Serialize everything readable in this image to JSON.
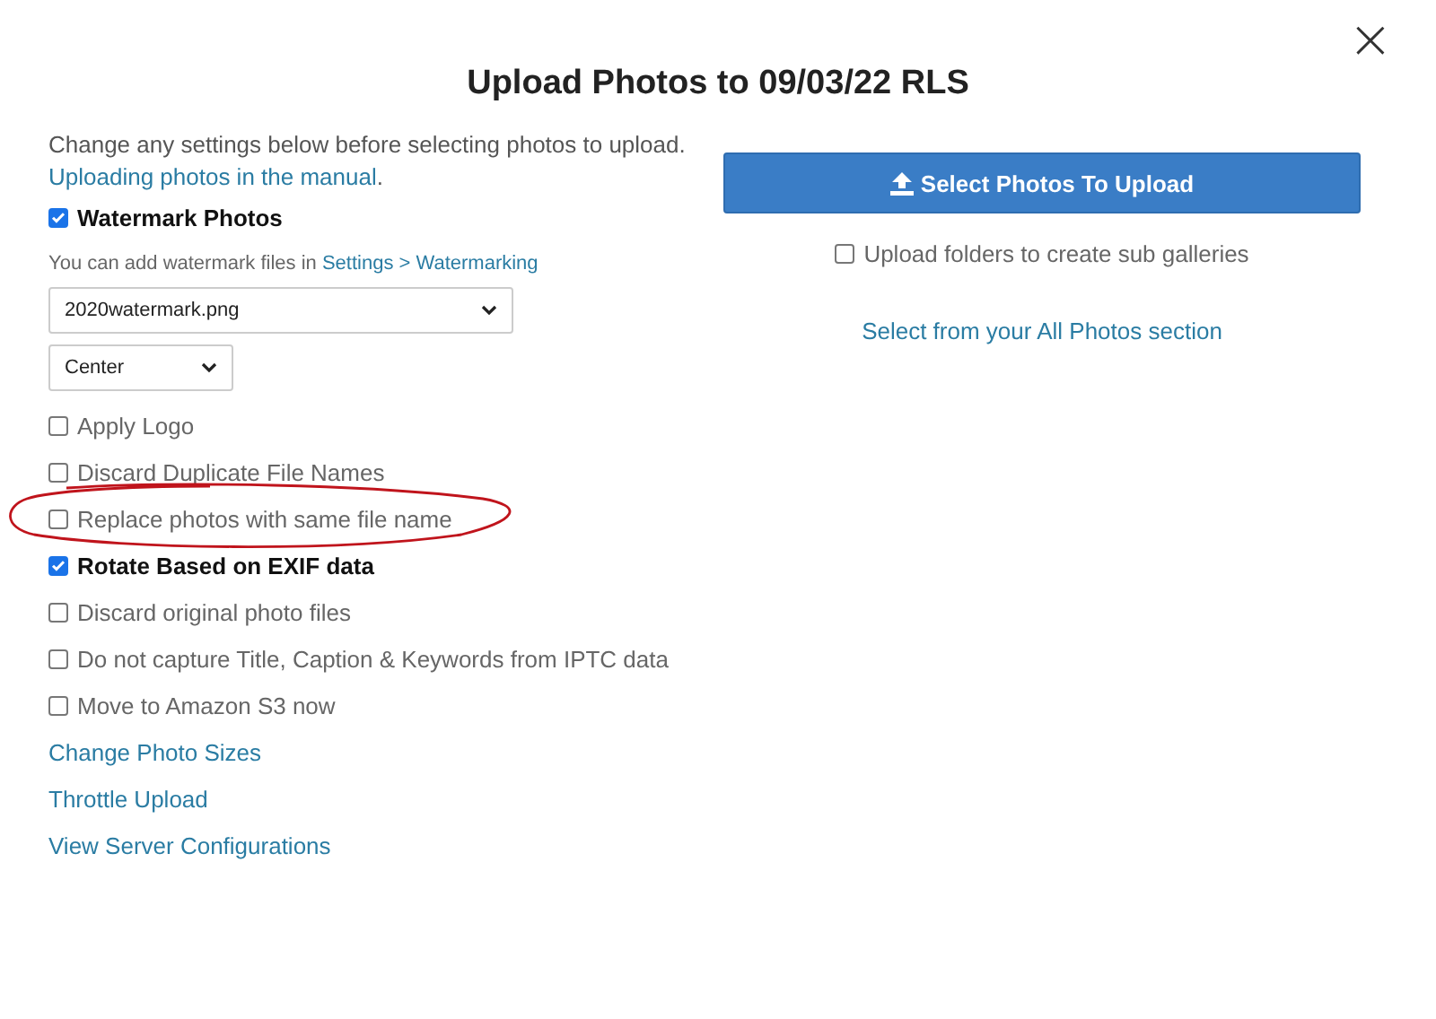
{
  "dialog": {
    "title": "Upload Photos to 09/03/22 RLS",
    "close": "×"
  },
  "intro": {
    "text": "Change any settings below before selecting photos to upload.",
    "link": "Uploading photos in the manual",
    "link_suffix": "."
  },
  "watermark": {
    "label": "Watermark Photos",
    "checked": true,
    "hint": "You can add watermark files in ",
    "hint_link": "Settings > Watermarking",
    "file_value": "2020watermark.png",
    "position_value": "Center"
  },
  "options": [
    {
      "label": "Apply Logo",
      "checked": false,
      "highlighted": false
    },
    {
      "label": "Discard Duplicate File Names",
      "checked": false,
      "highlighted": false
    },
    {
      "label": "Replace photos with same file name",
      "checked": false,
      "highlighted": true
    },
    {
      "label": "Rotate Based on EXIF data",
      "checked": true,
      "highlighted": false
    },
    {
      "label": "Discard original photo files",
      "checked": false,
      "highlighted": false
    },
    {
      "label": "Do not capture Title, Caption & Keywords from IPTC data",
      "checked": false,
      "highlighted": false
    },
    {
      "label": "Move to Amazon S3 now",
      "checked": false,
      "highlighted": false
    }
  ],
  "links": [
    "Change Photo Sizes",
    "Throttle Upload",
    "View Server Configurations"
  ],
  "upload": {
    "button": "Select Photos To Upload",
    "folders": {
      "label": "Upload folders to create sub galleries",
      "checked": false
    },
    "all_photos_link": "Select from your All Photos section"
  }
}
